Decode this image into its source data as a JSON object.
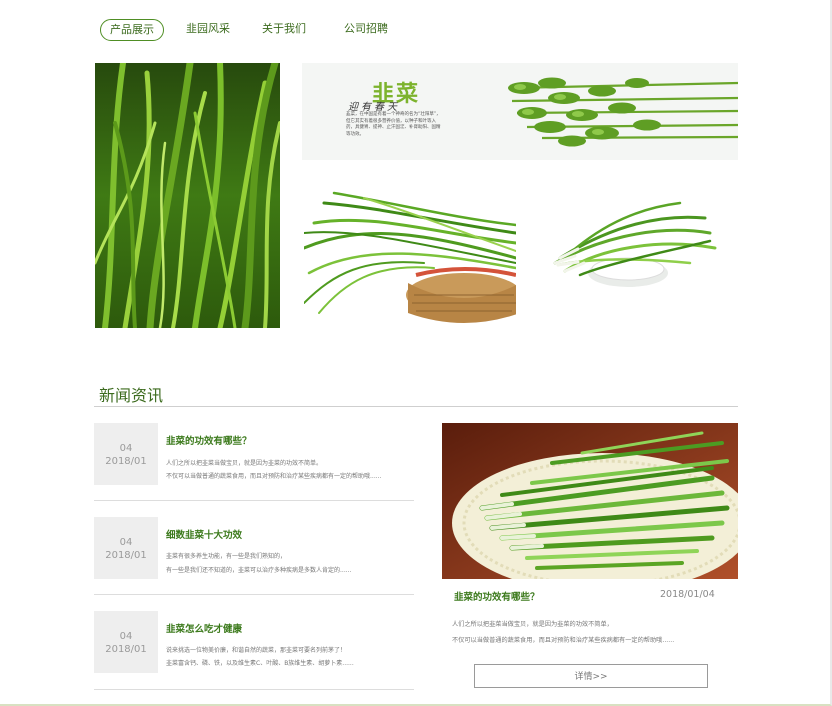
{
  "nav": {
    "items": [
      {
        "label": "产品展示",
        "active": true
      },
      {
        "label": "韭园风采",
        "active": false
      },
      {
        "label": "关于我们",
        "active": false
      },
      {
        "label": "公司招聘",
        "active": false
      }
    ]
  },
  "gallery": {
    "banner_title": "韭菜",
    "banner_sub": "迎有春天",
    "banner_body": "韭菜，在中国是有着一个神奇的名为“壮阳草”，但它其实有着很多营养价值，以种子和叶等入药，具健胃、提神、止汗固涩、补肾助阳、固精等功效。"
  },
  "news": {
    "section_title": "新闻资讯",
    "items": [
      {
        "day": "04",
        "ym": "2018/01",
        "title": "韭菜的功效有哪些？",
        "line1": "人们之所以把韭菜当做宝贝，就是因为韭菜的功效不简单。",
        "line2": "不仅可以当做普通的蔬菜食用，而且对预防和治疗某些疾病都有一定的帮助哦......"
      },
      {
        "day": "04",
        "ym": "2018/01",
        "title": "细数韭菜十大功效",
        "line1": "韭菜有很多养生功能，有一些是我们熟知的，",
        "line2": "有一些是我们还不知道的，韭菜可以治疗多种疾病是多数人肯定的......"
      },
      {
        "day": "04",
        "ym": "2018/01",
        "title": "韭菜怎么吃才健康",
        "line1": "说来挑选一位物美价廉，和谐自然的蔬菜，那韭菜可要名列前茅了！",
        "line2": "韭菜富含钙、磷、铁，以及维生素C、叶酸、B族维生素、胡萝卜素......"
      }
    ],
    "feature": {
      "title": "韭菜的功效有哪些？",
      "date": "2018/01/04",
      "line1": "人们之所以把韭菜当做宝贝，就是因为韭菜的功效不简单，",
      "line2": "不仅可以当做普通的蔬菜食用，而且对预防和治疗某些疾病都有一定的帮助哦......",
      "button_label": "详情>>"
    }
  },
  "colors": {
    "accent": "#3c7a1c",
    "nav_border": "#4f8e24",
    "date_bg": "#eeeeee"
  }
}
